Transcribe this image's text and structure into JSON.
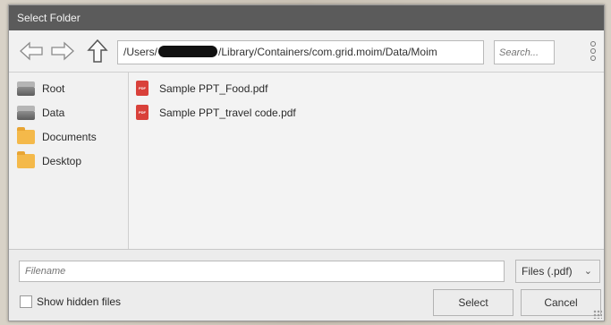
{
  "dialog": {
    "title": "Select Folder"
  },
  "toolbar": {
    "path_prefix": "/Users/",
    "path_suffix": "/Library/Containers/com.grid.moim/Data/Moim",
    "search_placeholder": "Search..."
  },
  "sidebar": {
    "items": [
      {
        "label": "Root",
        "icon": "drive-icon"
      },
      {
        "label": "Data",
        "icon": "drive-icon"
      },
      {
        "label": "Documents",
        "icon": "folder-icon"
      },
      {
        "label": "Desktop",
        "icon": "folder-icon"
      }
    ]
  },
  "files": {
    "items": [
      {
        "label": "Sample PPT_Food.pdf",
        "icon": "pdf-icon"
      },
      {
        "label": "Sample PPT_travel code.pdf",
        "icon": "pdf-icon"
      }
    ]
  },
  "footer": {
    "filename_placeholder": "Filename",
    "filetype": "Files (.pdf)",
    "show_hidden_label": "Show hidden files",
    "select_label": "Select",
    "cancel_label": "Cancel"
  },
  "colors": {
    "titlebar": "#5b5b5b",
    "pdf": "#d9413a",
    "folder": "#f4b94a"
  }
}
